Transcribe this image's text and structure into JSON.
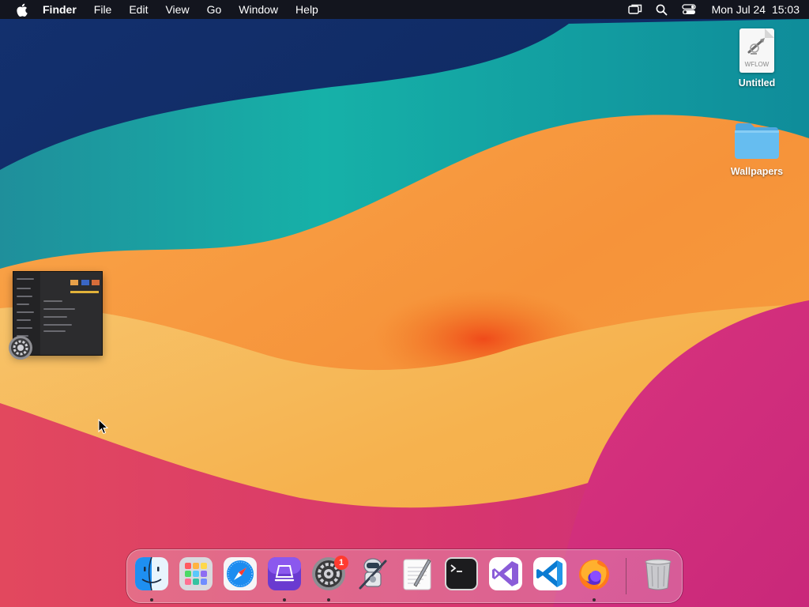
{
  "menubar": {
    "app_name": "Finder",
    "menus": [
      "File",
      "Edit",
      "View",
      "Go",
      "Window",
      "Help"
    ],
    "status_icons": [
      "screen-mirroring-icon",
      "search-icon",
      "control-center-icon"
    ],
    "clock": {
      "date": "Mon Jul 24",
      "time": "15:03"
    }
  },
  "desktop": {
    "icons": [
      {
        "label": "Untitled",
        "type": "wflow-document",
        "ext": "WFLOW"
      },
      {
        "label": "Wallpapers",
        "type": "folder"
      }
    ]
  },
  "thumbnail": {
    "app_icon": "system-settings-icon"
  },
  "dock": {
    "apps": [
      {
        "name": "finder-icon",
        "running": true
      },
      {
        "name": "launchpad-icon",
        "running": false
      },
      {
        "name": "safari-icon",
        "running": false
      },
      {
        "name": "simulator-icon",
        "running": true
      },
      {
        "name": "system-settings-icon",
        "running": true,
        "badge": "1"
      },
      {
        "name": "automator-icon",
        "running": false
      },
      {
        "name": "textedit-icon",
        "running": false
      },
      {
        "name": "terminal-icon",
        "running": false
      },
      {
        "name": "visual-studio-icon",
        "running": false
      },
      {
        "name": "vscode-icon",
        "running": false
      },
      {
        "name": "firefox-icon",
        "running": true
      },
      {
        "name": "trash-icon",
        "running": false
      }
    ]
  },
  "colors": {
    "menubar_bg": "#141418",
    "folder_blue": "#5fb5ec",
    "badge_red": "#ff3b30"
  }
}
